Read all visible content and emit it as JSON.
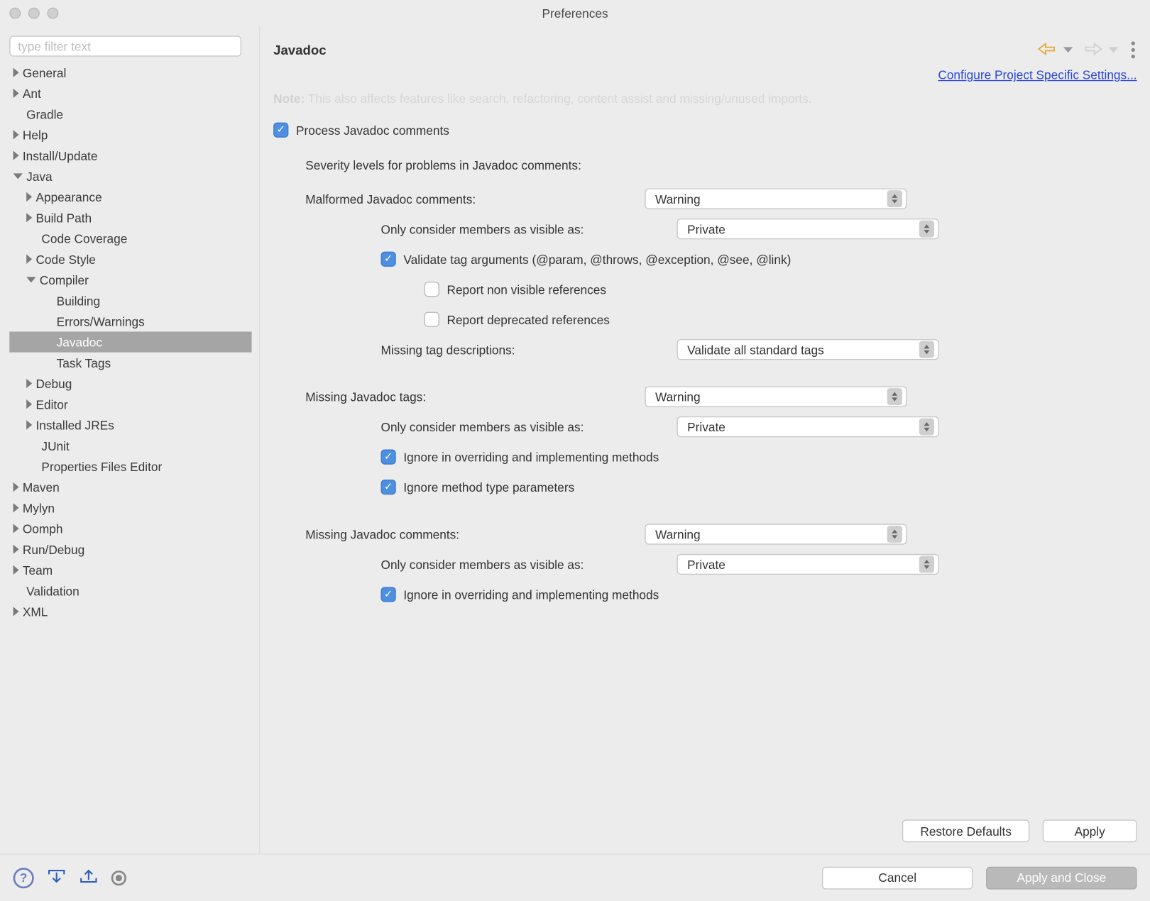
{
  "window": {
    "title": "Preferences"
  },
  "sidebar": {
    "filter_placeholder": "type filter text",
    "items": {
      "general": "General",
      "ant": "Ant",
      "gradle": "Gradle",
      "help": "Help",
      "install_update": "Install/Update",
      "java": "Java",
      "appearance": "Appearance",
      "build_path": "Build Path",
      "code_coverage": "Code Coverage",
      "code_style": "Code Style",
      "compiler": "Compiler",
      "building": "Building",
      "errors_warnings": "Errors/Warnings",
      "javadoc": "Javadoc",
      "task_tags": "Task Tags",
      "debug": "Debug",
      "editor": "Editor",
      "installed_jres": "Installed JREs",
      "junit": "JUnit",
      "properties_files_editor": "Properties Files Editor",
      "maven": "Maven",
      "mylyn": "Mylyn",
      "oomph": "Oomph",
      "run_debug": "Run/Debug",
      "team": "Team",
      "validation": "Validation",
      "xml": "XML"
    }
  },
  "main": {
    "title": "Javadoc",
    "config_link": "Configure Project Specific Settings...",
    "note_label": "Note:",
    "note_text": "This also affects features like search, refactoring, content assist and missing/unused imports.",
    "process_javadoc": "Process Javadoc comments",
    "severity_title": "Severity levels for problems in Javadoc comments:",
    "malformed_label": "Malformed Javadoc comments:",
    "malformed_value": "Warning",
    "only_consider_label": "Only consider members as visible as:",
    "malformed_visibility": "Private",
    "validate_tag_args": "Validate tag arguments (@param, @throws, @exception, @see, @link)",
    "report_non_visible": "Report non visible references",
    "report_deprecated": "Report deprecated references",
    "missing_tag_desc_label": "Missing tag descriptions:",
    "missing_tag_desc_value": "Validate all standard tags",
    "missing_tags_label": "Missing Javadoc tags:",
    "missing_tags_value": "Warning",
    "missing_tags_visibility": "Private",
    "ignore_overriding": "Ignore in overriding and implementing methods",
    "ignore_method_type": "Ignore method type parameters",
    "missing_comments_label": "Missing Javadoc comments:",
    "missing_comments_value": "Warning",
    "missing_comments_visibility": "Private"
  },
  "buttons": {
    "restore_defaults": "Restore Defaults",
    "apply": "Apply",
    "cancel": "Cancel",
    "apply_close": "Apply and Close"
  }
}
